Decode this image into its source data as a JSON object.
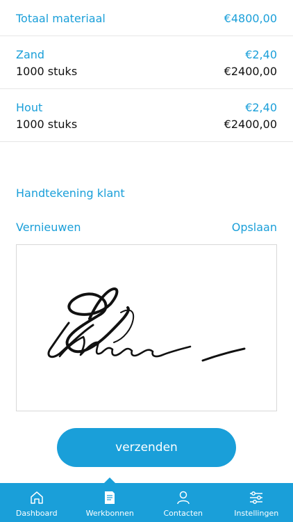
{
  "summary": {
    "label": "Totaal materiaal",
    "value": "€4800,00"
  },
  "items": [
    {
      "name": "Zand",
      "unit_price": "€2,40",
      "quantity": "1000 stuks",
      "total": "€2400,00"
    },
    {
      "name": "Hout",
      "unit_price": "€2,40",
      "quantity": "1000 stuks",
      "total": "€2400,00"
    }
  ],
  "signature": {
    "label": "Handtekening klant",
    "renew_label": "Vernieuwen",
    "save_label": "Opslaan"
  },
  "send_button": "verzenden",
  "tabbar": {
    "active": "Werkbonnen",
    "tabs": [
      {
        "label": "Dashboard",
        "icon": "home-icon"
      },
      {
        "label": "Werkbonnen",
        "icon": "document-icon"
      },
      {
        "label": "Contacten",
        "icon": "person-icon"
      },
      {
        "label": "Instellingen",
        "icon": "sliders-icon"
      }
    ]
  },
  "colors": {
    "accent": "#1a9fd9",
    "text": "#111111",
    "divider": "#e6e6e6"
  }
}
